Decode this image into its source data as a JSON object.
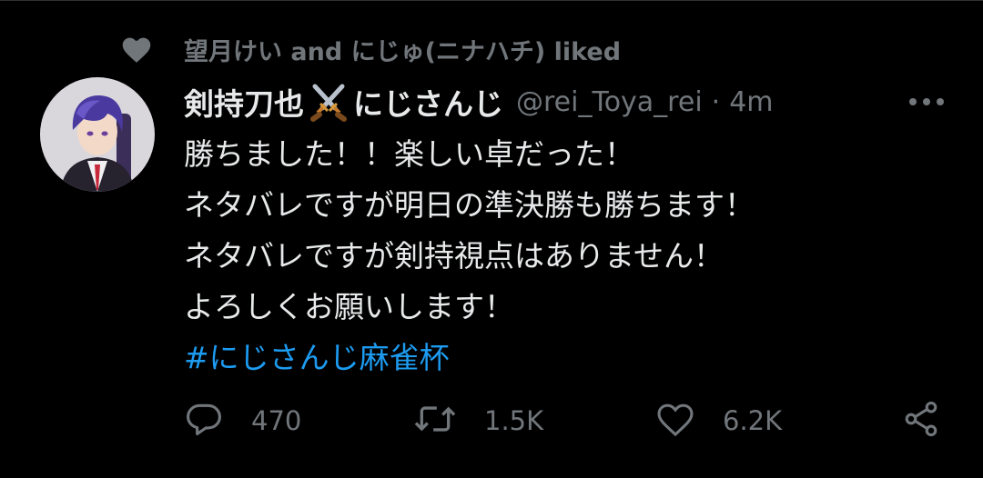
{
  "social_context": {
    "text": "望月けい and にじゅ(ニナハチ) liked"
  },
  "tweet": {
    "display_name": "剣持刀也",
    "display_name_suffix": "にじさんじ",
    "handle": "@rei_Toya_rei",
    "separator": "·",
    "time": "4m",
    "lines": [
      "勝ちました！！楽しい卓だった！",
      "ネタバレですが明日の準決勝も勝ちます！",
      "ネタバレですが剣持視点はありません！",
      "よろしくお願いします！"
    ],
    "hashtag": "#にじさんじ麻雀杯"
  },
  "actions": {
    "reply_count": "470",
    "retweet_count": "1.5K",
    "like_count": "6.2K"
  },
  "icons": {
    "liked": "heart-filled-icon",
    "name_emoji": "crossed-swords-icon",
    "more": "more-horizontal-icon",
    "reply": "reply-icon",
    "retweet": "retweet-icon",
    "like": "heart-outline-icon",
    "share": "share-icon"
  },
  "colors": {
    "background": "#000000",
    "text": "#e7e9ea",
    "muted": "#71767b",
    "link": "#1d9bf0"
  }
}
